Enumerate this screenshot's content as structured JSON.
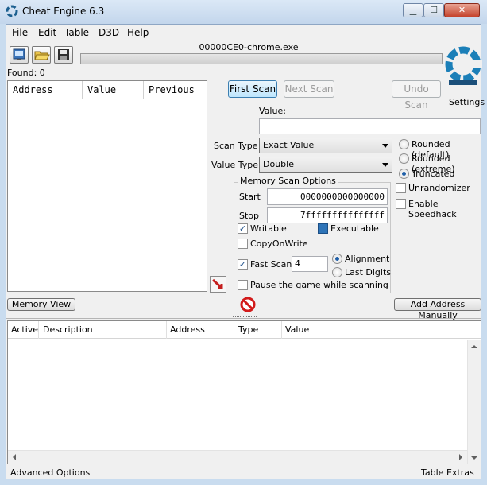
{
  "window": {
    "title": "Cheat Engine 6.3",
    "minimize_glyph": "▁",
    "maximize_glyph": "☐",
    "close_glyph": "✕"
  },
  "menu": [
    "File",
    "Edit",
    "Table",
    "D3D",
    "Help"
  ],
  "toolbar": {
    "process_name": "00000CE0-chrome.exe",
    "found": "Found: 0",
    "settings": "Settings",
    "icons": [
      "select-process-icon",
      "open-file-icon",
      "save-file-icon"
    ]
  },
  "results": {
    "columns": [
      "Address",
      "Value",
      "Previous"
    ]
  },
  "scan": {
    "first_scan": "First Scan",
    "next_scan": "Next Scan",
    "undo_scan": "Undo Scan",
    "value_label": "Value:",
    "value_input": "",
    "scan_type_label": "Scan Type",
    "scan_type_value": "Exact Value",
    "value_type_label": "Value Type",
    "value_type_value": "Double"
  },
  "rounding": {
    "options": [
      "Rounded (default)",
      "Rounded (extreme)",
      "Truncated"
    ],
    "selected": "Truncated",
    "unrandomizer": "Unrandomizer",
    "speedhack": "Enable Speedhack"
  },
  "memory_options": {
    "title": "Memory Scan Options",
    "start_label": "Start",
    "start_value": "0000000000000000",
    "stop_label": "Stop",
    "stop_value": "7fffffffffffffff",
    "writable": "Writable",
    "executable": "Executable",
    "copyonwrite": "CopyOnWrite",
    "fastscan": "Fast Scan",
    "fastscan_value": "4",
    "alignment": "Alignment",
    "last_digits": "Last Digits",
    "pause": "Pause the game while scanning"
  },
  "bottom": {
    "memory_view": "Memory View",
    "add_address": "Add Address Manually",
    "columns": [
      "Active",
      "Description",
      "Address",
      "Type",
      "Value"
    ],
    "advanced_options": "Advanced Options",
    "table_extras": "Table Extras"
  },
  "colors": {
    "accent": "#1f5fa8",
    "logo": "#1b7fb8",
    "stop_red": "#d21b1b"
  }
}
